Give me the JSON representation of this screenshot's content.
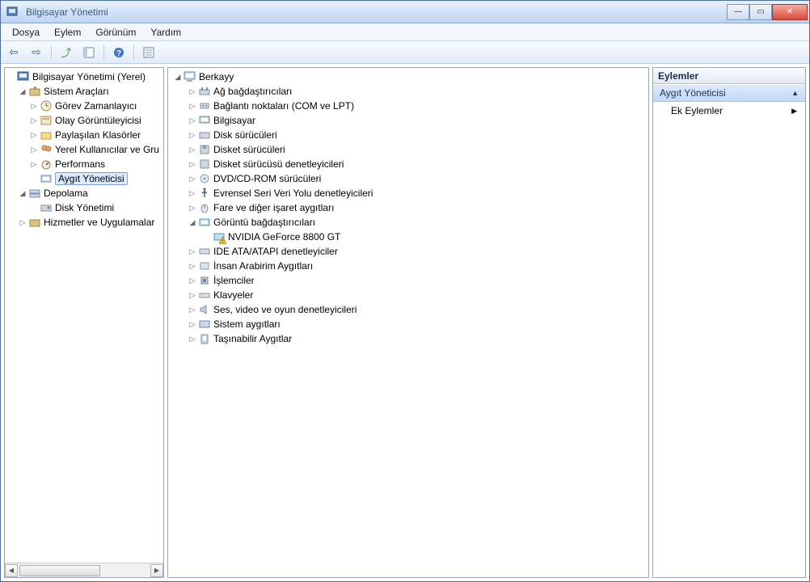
{
  "window": {
    "title": "Bilgisayar Yönetimi"
  },
  "menu": {
    "file": "Dosya",
    "action": "Eylem",
    "view": "Görünüm",
    "help": "Yardım"
  },
  "left_tree": {
    "root": "Bilgisayar Yönetimi (Yerel)",
    "sys_tools": "Sistem Araçları",
    "task_scheduler": "Görev Zamanlayıcı",
    "event_viewer": "Olay Görüntüleyicisi",
    "shared_folders": "Paylaşılan Klasörler",
    "local_users": "Yerel Kullanıcılar ve Gru",
    "performance": "Performans",
    "device_manager": "Aygıt Yöneticisi",
    "storage": "Depolama",
    "disk_mgmt": "Disk Yönetimi",
    "services_apps": "Hizmetler ve Uygulamalar"
  },
  "device_tree": {
    "root": "Berkayy",
    "items": {
      "network": "Ağ bağdaştırıcıları",
      "ports": "Bağlantı noktaları (COM ve LPT)",
      "computer": "Bilgisayar",
      "disk_drives": "Disk sürücüleri",
      "floppy": "Disket sürücüleri",
      "floppy_ctrl": "Disket sürücüsü denetleyicileri",
      "dvd": "DVD/CD-ROM sürücüleri",
      "usb": "Evrensel Seri Veri Yolu denetleyicileri",
      "mice": "Fare ve diğer işaret aygıtları",
      "display": "Görüntü bağdaştırıcıları",
      "display_child": "NVIDIA GeForce 8800 GT",
      "ide": "IDE ATA/ATAPI denetleyiciler",
      "hid": "İnsan Arabirim Aygıtları",
      "cpu": "İşlemciler",
      "keyboard": "Klavyeler",
      "sound": "Ses, video ve oyun denetleyicileri",
      "sys_dev": "Sistem aygıtları",
      "portable": "Taşınabilir Aygıtlar"
    }
  },
  "actions": {
    "header": "Eylemler",
    "section": "Aygıt Yöneticisi",
    "more": "Ek Eylemler"
  }
}
